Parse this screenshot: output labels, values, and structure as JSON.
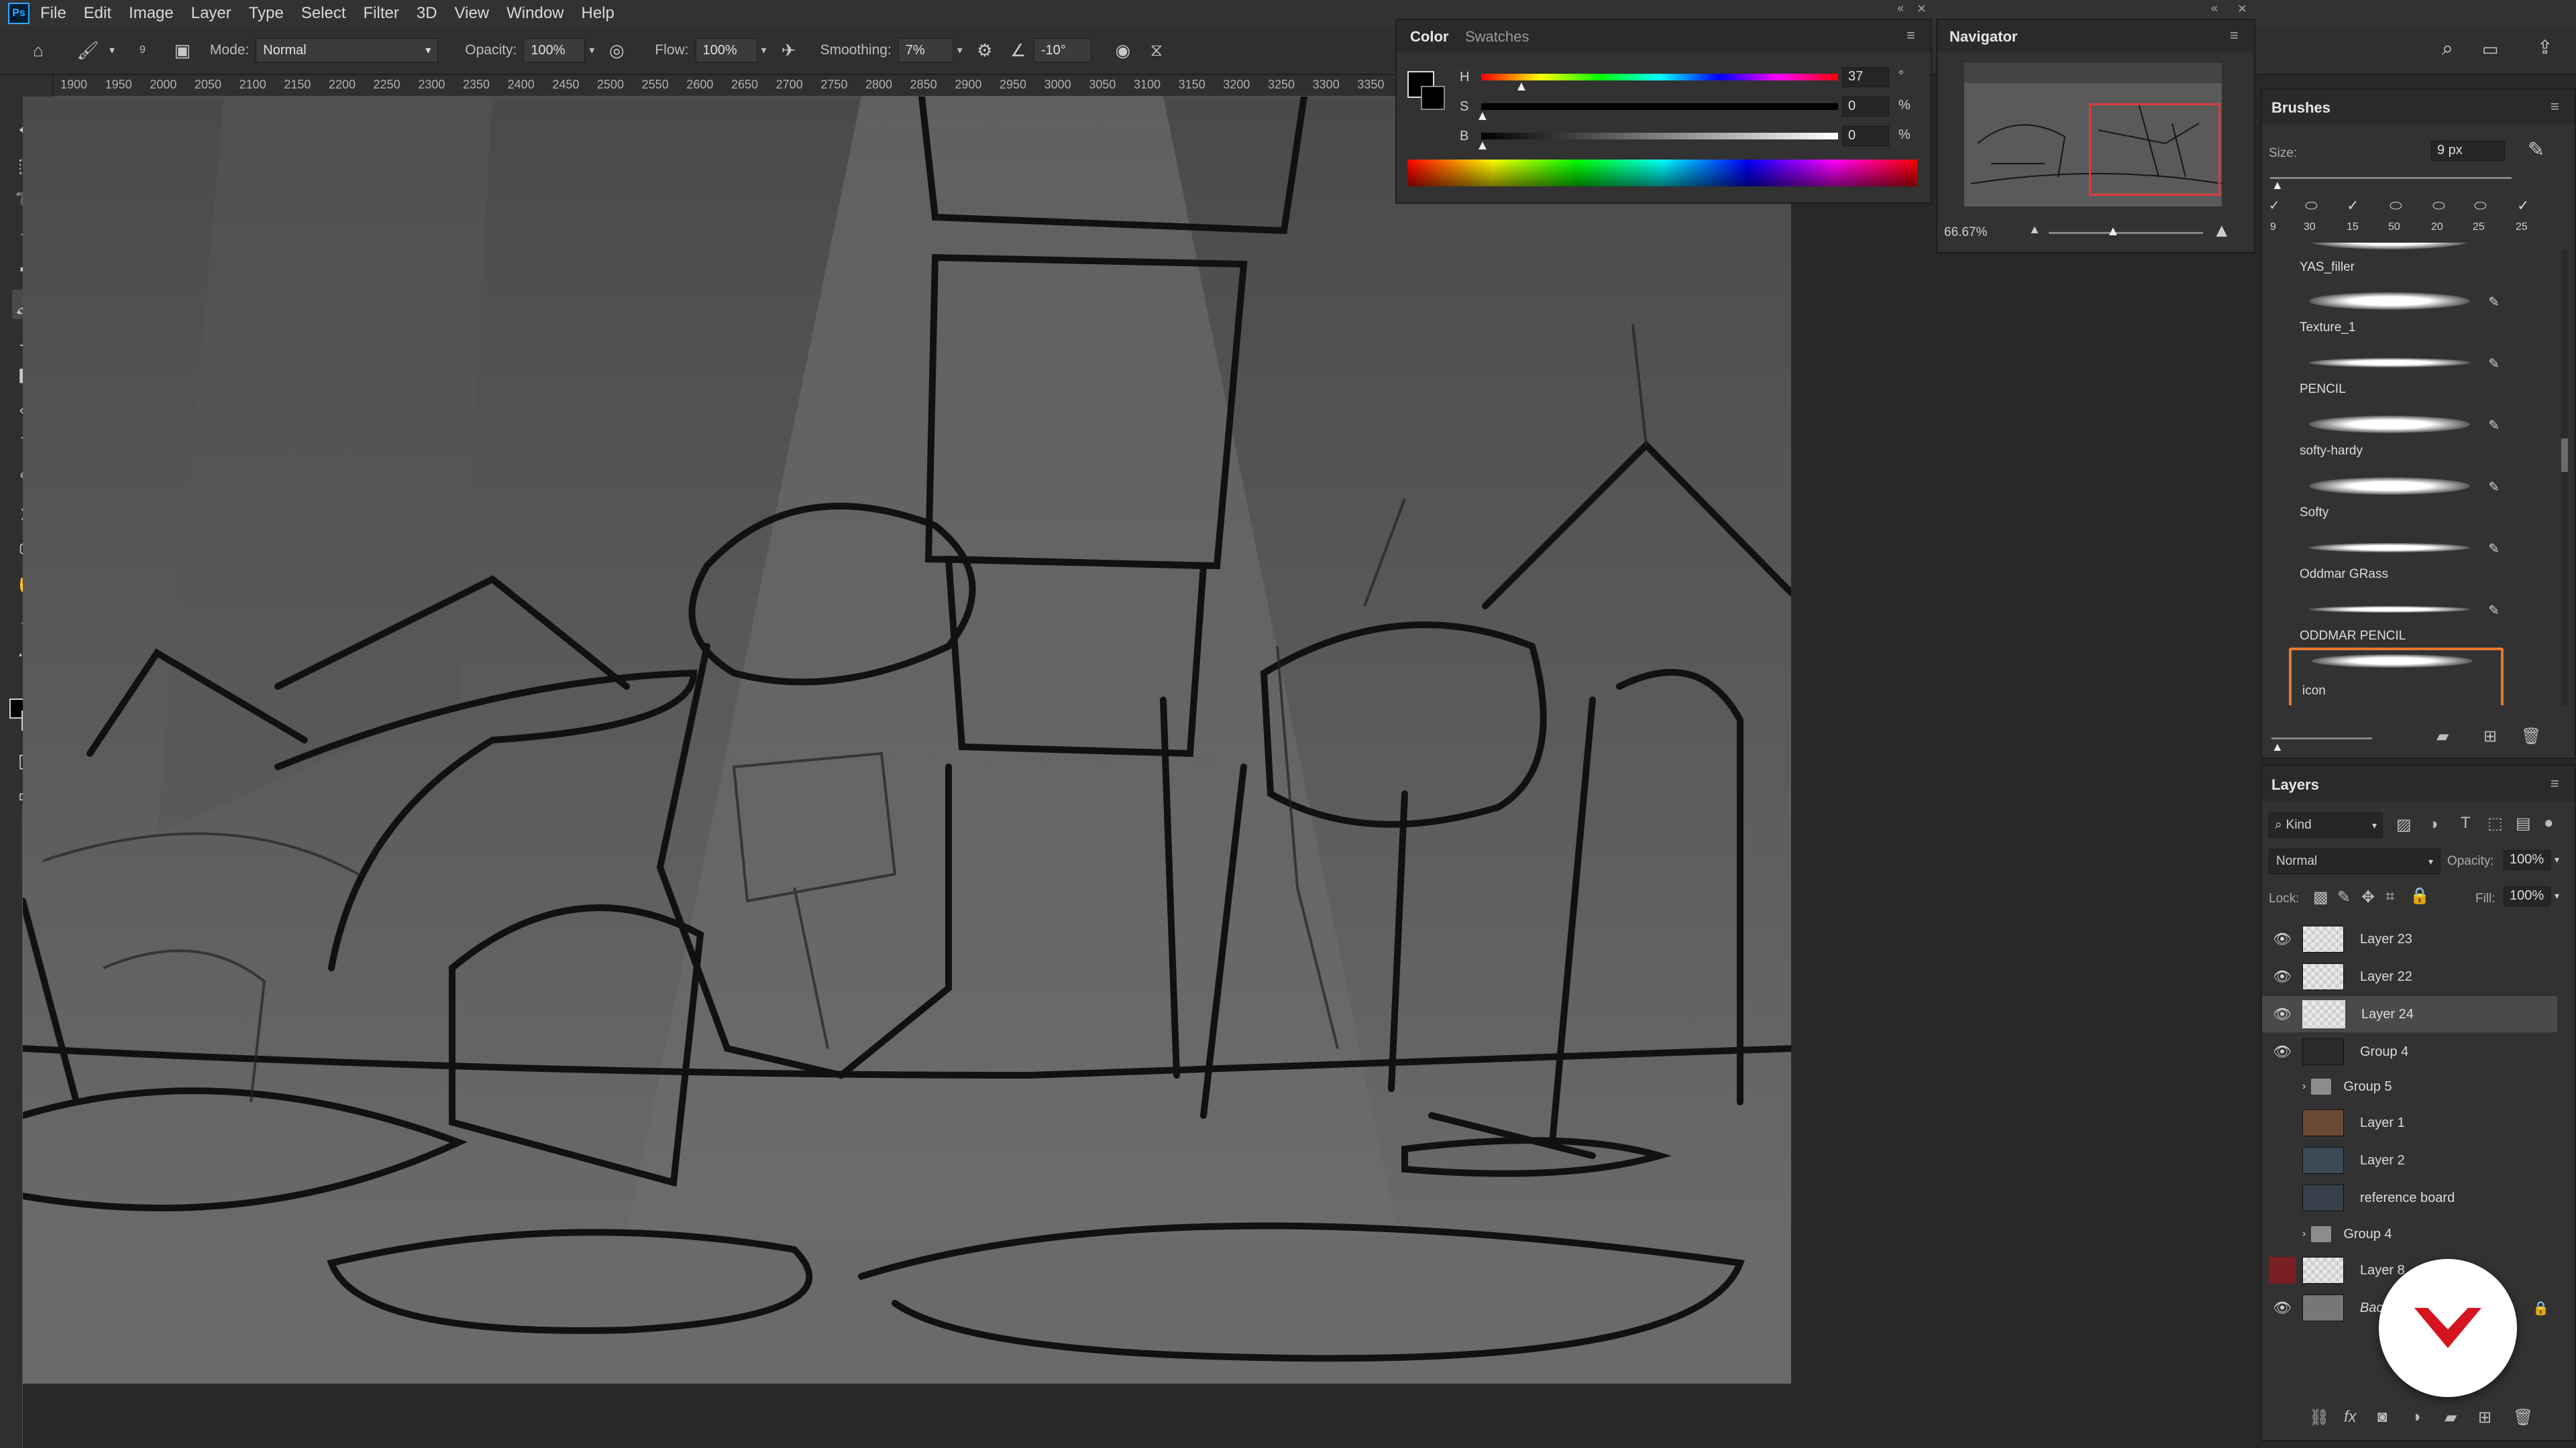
{
  "menubar": {
    "app_logo": "Ps",
    "items": [
      "File",
      "Edit",
      "Image",
      "Layer",
      "Type",
      "Select",
      "Filter",
      "3D",
      "View",
      "Window",
      "Help"
    ]
  },
  "options": {
    "brush_size": "9",
    "mode_label": "Mode:",
    "mode_value": "Normal",
    "opacity_label": "Opacity:",
    "opacity_value": "100%",
    "flow_label": "Flow:",
    "flow_value": "100%",
    "smoothing_label": "Smoothing:",
    "smoothing_value": "7%",
    "angle_value": "-10°"
  },
  "ruler": {
    "ticks": [
      "1900",
      "1950",
      "2000",
      "2050",
      "2100",
      "2150",
      "2200",
      "2250",
      "2300",
      "2350",
      "2400",
      "2450",
      "2500",
      "2550",
      "2600",
      "2650",
      "2700",
      "2750",
      "2800",
      "2850",
      "2900",
      "2950",
      "3000",
      "3050",
      "3100",
      "3150",
      "3200",
      "3250",
      "3300",
      "3350"
    ]
  },
  "color_panel": {
    "tabs": [
      "Color",
      "Swatches"
    ],
    "h_label": "H",
    "h_value": "37",
    "h_unit": "°",
    "s_label": "S",
    "s_value": "0",
    "s_unit": "%",
    "b_label": "B",
    "b_value": "0",
    "b_unit": "%"
  },
  "navigator": {
    "title": "Navigator",
    "zoom": "66.67%"
  },
  "brushes": {
    "title": "Brushes",
    "size_label": "Size:",
    "size_value": "9 px",
    "presets": [
      "9",
      "30",
      "15",
      "50",
      "20",
      "25",
      "25"
    ],
    "items": [
      "YAS_filler",
      "Texture_1",
      "PENCIL",
      "softy-hardy",
      "Softy",
      "Oddmar GRass",
      "ODDMAR PENCIL",
      "icon"
    ],
    "selected": "icon"
  },
  "layers": {
    "title": "Layers",
    "filter_label": "Kind",
    "blend_mode": "Normal",
    "opacity_label": "Opacity:",
    "opacity_value": "100%",
    "lock_label": "Lock:",
    "fill_label": "Fill:",
    "fill_value": "100%",
    "rows": [
      {
        "name": "Layer 23",
        "visible": true
      },
      {
        "name": "Layer 22",
        "visible": true
      },
      {
        "name": "Layer 24",
        "visible": true,
        "selected": true
      },
      {
        "name": "Group 4",
        "visible": true
      },
      {
        "name": "Group 5",
        "visible": false
      },
      {
        "name": "Layer 1",
        "visible": false
      },
      {
        "name": "Layer 2",
        "visible": false
      },
      {
        "name": "reference board",
        "visible": false
      },
      {
        "name": "Group 4",
        "visible": false
      },
      {
        "name": "Layer 8",
        "visible": false
      },
      {
        "name": "Background",
        "visible": true
      }
    ]
  },
  "colors": {
    "accent_orange": "#e8792b",
    "brand_red": "#d4151f",
    "nav_frame": "#e03a3a"
  }
}
